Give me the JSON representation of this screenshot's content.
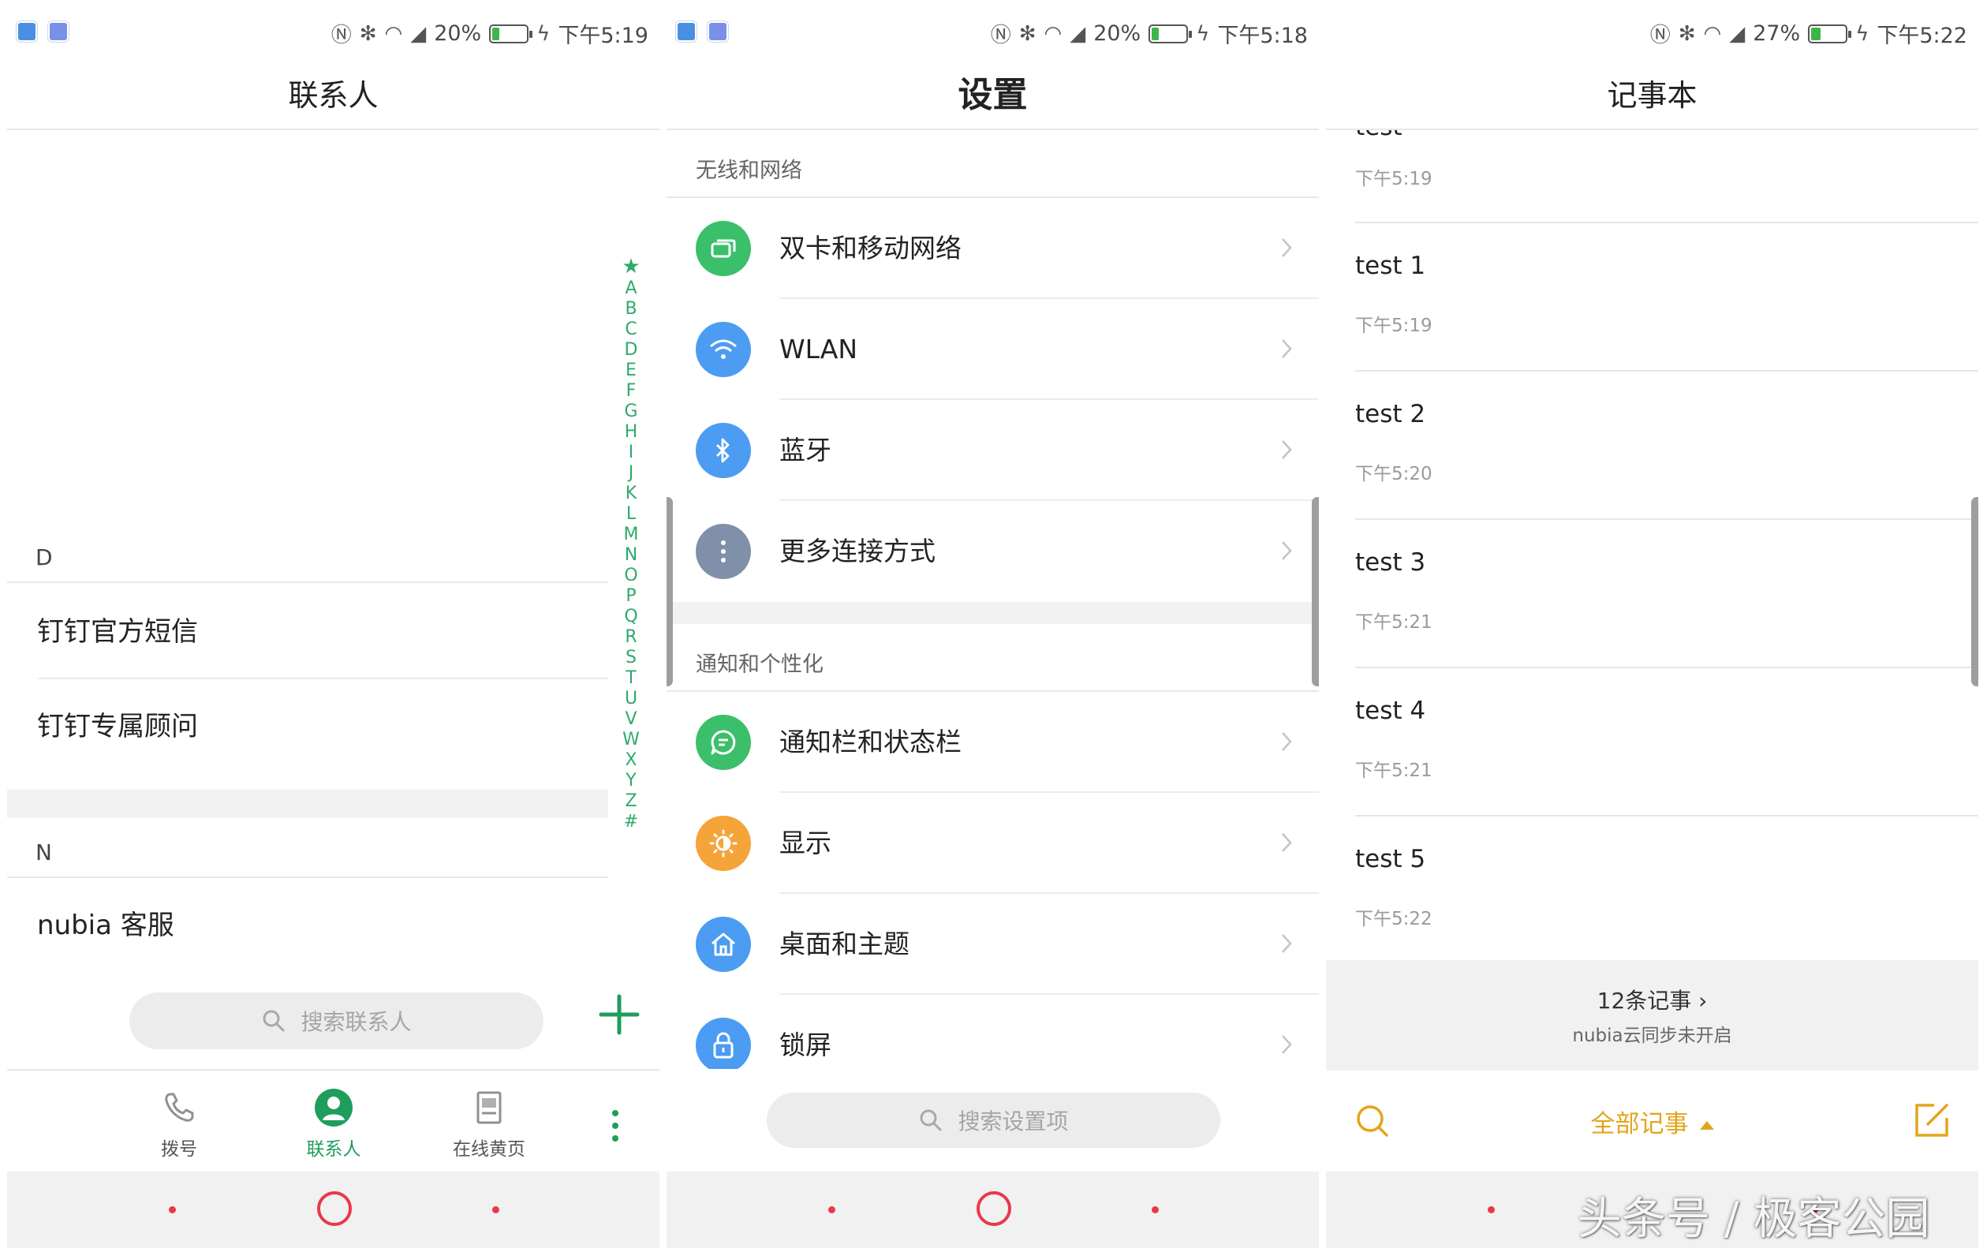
{
  "colors": {
    "contacts_accent": "#1e9d5d",
    "notes_accent": "#e3a51c",
    "nav_red": "#e8394a",
    "battery_green": "#3cb54a"
  },
  "contacts_screen": {
    "status": {
      "battery": "20%",
      "battery_level": 0.2,
      "time": "下午5:19"
    },
    "title": "联系人",
    "sections": [
      {
        "letter": "D",
        "items": [
          "钉钉官方短信",
          "钉钉专属顾问"
        ]
      },
      {
        "letter": "N",
        "items": [
          "nubia 客服"
        ]
      }
    ],
    "alphabet": [
      "★",
      "A",
      "B",
      "C",
      "D",
      "E",
      "F",
      "G",
      "H",
      "I",
      "J",
      "K",
      "L",
      "M",
      "N",
      "O",
      "P",
      "Q",
      "R",
      "S",
      "T",
      "U",
      "V",
      "W",
      "X",
      "Y",
      "Z",
      "#"
    ],
    "search_placeholder": "搜索联系人",
    "tabs": [
      {
        "label": "拨号",
        "icon": "phone-icon"
      },
      {
        "label": "联系人",
        "icon": "contact-person-icon",
        "active": true
      },
      {
        "label": "在线黄页",
        "icon": "yellow-pages-icon"
      }
    ]
  },
  "settings_screen": {
    "status": {
      "battery": "20%",
      "battery_level": 0.2,
      "time": "下午5:18"
    },
    "title": "设置",
    "section1": {
      "header": "无线和网络",
      "items": [
        {
          "label": "双卡和移动网络",
          "icon": "dual-sim-icon",
          "color": "#3cbf6b"
        },
        {
          "label": "WLAN",
          "icon": "wifi-icon",
          "color": "#4b9cf2"
        },
        {
          "label": "蓝牙",
          "icon": "bluetooth-icon",
          "color": "#4b9cf2"
        },
        {
          "label": "更多连接方式",
          "icon": "more-dots-icon",
          "color": "#8090a8"
        }
      ]
    },
    "section2": {
      "header": "通知和个性化",
      "items": [
        {
          "label": "通知栏和状态栏",
          "icon": "notification-icon",
          "color": "#3cbf6b"
        },
        {
          "label": "显示",
          "icon": "brightness-icon",
          "color": "#f5a43a"
        },
        {
          "label": "桌面和主题",
          "icon": "home-icon",
          "color": "#4b9cf2"
        },
        {
          "label": "锁屏",
          "icon": "lock-icon",
          "color": "#4b9cf2"
        }
      ]
    },
    "search_placeholder": "搜索设置项"
  },
  "notes_screen": {
    "status": {
      "battery": "27%",
      "battery_level": 0.27,
      "time": "下午5:22"
    },
    "title": "记事本",
    "partial_note": {
      "title": "test",
      "time": "下午5:19"
    },
    "notes": [
      {
        "title": "test 1",
        "time": "下午5:19"
      },
      {
        "title": "test 2",
        "time": "下午5:20"
      },
      {
        "title": "test 3",
        "time": "下午5:21"
      },
      {
        "title": "test 4",
        "time": "下午5:21"
      },
      {
        "title": "test 5",
        "time": "下午5:22"
      }
    ],
    "summary": {
      "count": "12条记事 ›",
      "sync": "nubia云同步未开启"
    },
    "filter": "全部记事"
  },
  "watermark": "头条号 / 极客公园"
}
